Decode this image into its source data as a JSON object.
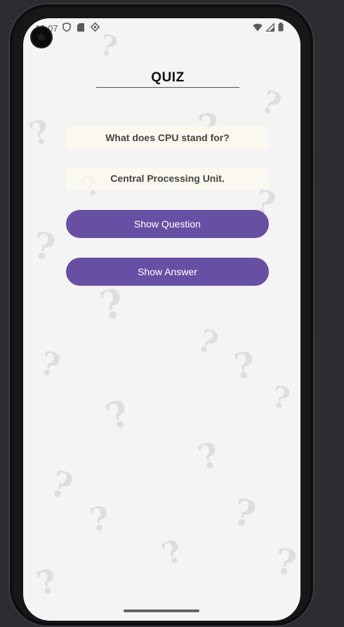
{
  "status_bar": {
    "time": "12:07",
    "icons_left": [
      "shield-icon",
      "sd-card-icon",
      "debug-icon"
    ],
    "icons_right": [
      "wifi-icon",
      "signal-icon",
      "battery-icon"
    ]
  },
  "app": {
    "title": "QUIZ",
    "question_text": "What does CPU stand for?",
    "answer_text": "Central Processing Unit.",
    "show_question_label": "Show Question",
    "show_answer_label": "Show Answer"
  },
  "colors": {
    "button": "#6750a4",
    "button_text": "#ffffff",
    "title": "#111111",
    "card_text": "#444444"
  }
}
